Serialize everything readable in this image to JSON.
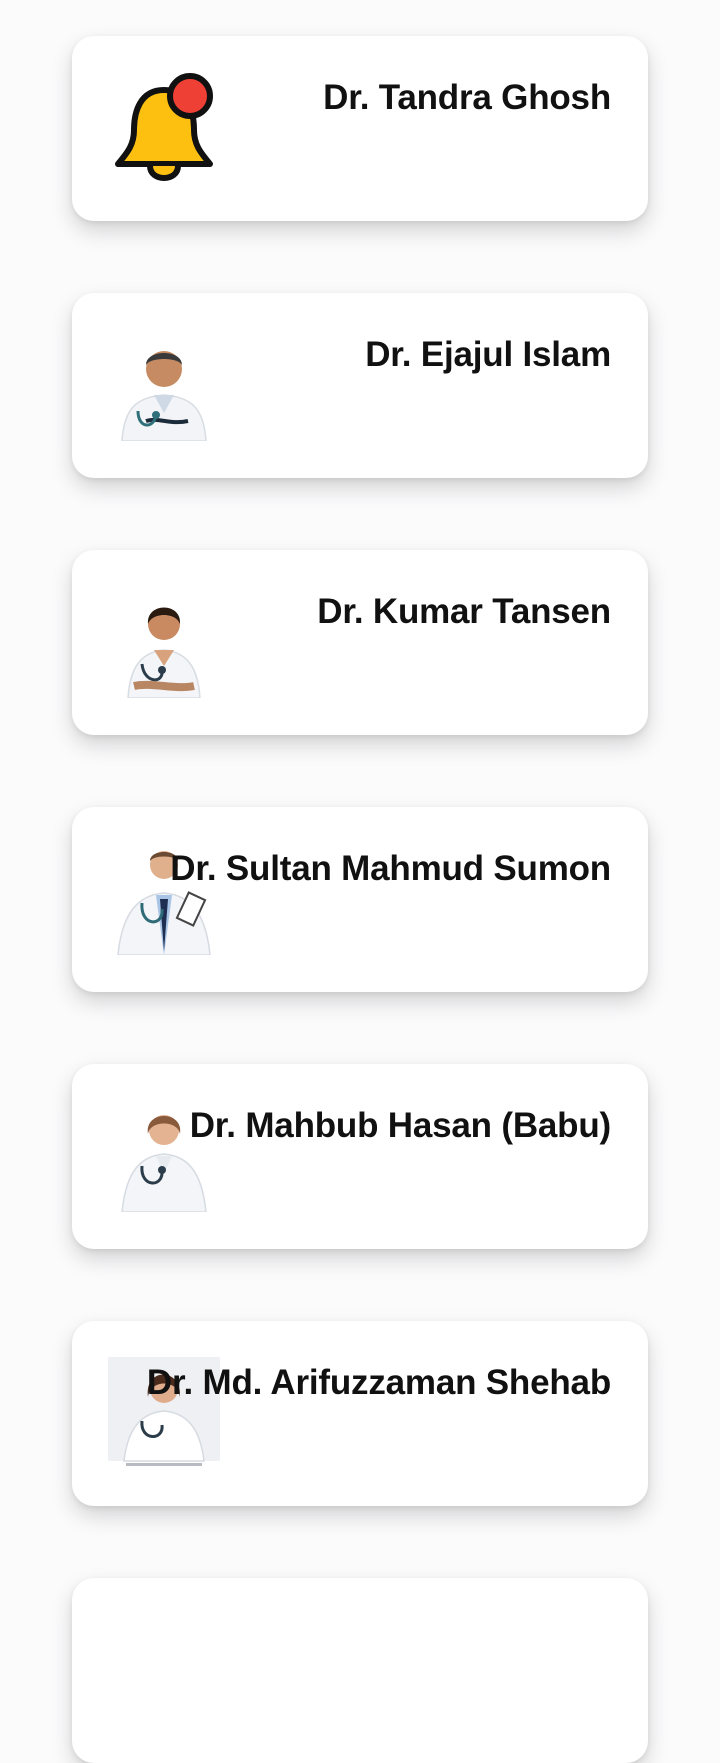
{
  "doctors": [
    {
      "name": "Dr. Tandra Ghosh",
      "avatar": "bell-notification-icon"
    },
    {
      "name": "Dr. Ejajul Islam",
      "avatar": "male-doctor-photo"
    },
    {
      "name": "Dr. Kumar Tansen",
      "avatar": "female-doctor-photo"
    },
    {
      "name": "Dr. Sultan Mahmud Sumon",
      "avatar": "male-doctor-clipboard-photo"
    },
    {
      "name": "Dr. Mahbub Hasan (Babu)",
      "avatar": "female-doctor-photo"
    },
    {
      "name": "Dr. Md. Arifuzzaman Shehab",
      "avatar": "female-doctor-stock-photo"
    }
  ],
  "colors": {
    "bell": "#FDC010",
    "bell_dot": "#EF4036",
    "outline": "#111111",
    "coat": "#F3F5F8",
    "skin": "#C68B62"
  }
}
